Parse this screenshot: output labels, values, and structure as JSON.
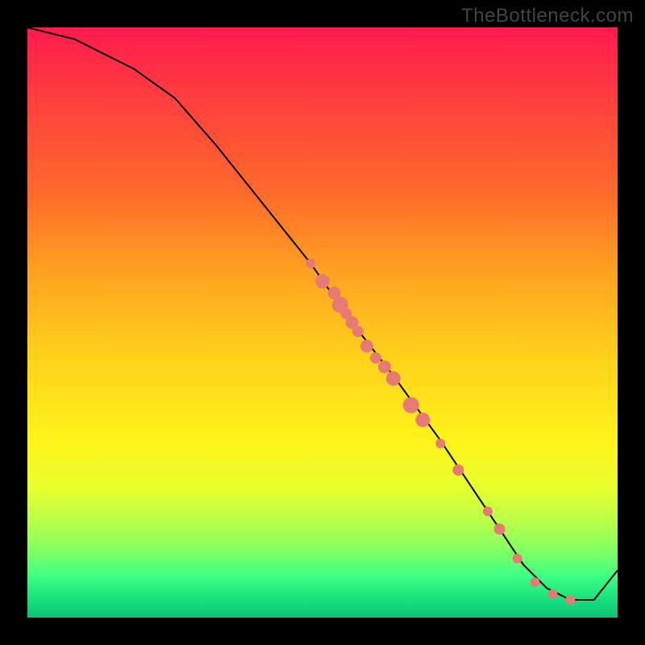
{
  "watermark": "TheBottleneck.com",
  "colors": {
    "page_bg": "#000000",
    "watermark": "#444444",
    "curve": "#000000",
    "dots": "#e87a74"
  },
  "chart_data": {
    "type": "line",
    "title": "",
    "xlabel": "",
    "ylabel": "",
    "xlim": [
      0,
      100
    ],
    "ylim": [
      0,
      100
    ],
    "grid": false,
    "legend": false,
    "curve": {
      "x": [
        0,
        4,
        8,
        12,
        18,
        25,
        32,
        40,
        48,
        55,
        62,
        70,
        78,
        84,
        88,
        92,
        96,
        100
      ],
      "y": [
        100,
        99,
        98,
        96,
        93,
        88,
        80,
        70,
        60,
        50,
        41,
        30,
        18,
        9,
        5,
        3,
        3,
        8
      ]
    },
    "scatter": [
      {
        "x": 48,
        "y": 60,
        "r": 6
      },
      {
        "x": 50,
        "y": 57,
        "r": 9
      },
      {
        "x": 52,
        "y": 55,
        "r": 8
      },
      {
        "x": 53,
        "y": 53,
        "r": 10
      },
      {
        "x": 54,
        "y": 51.5,
        "r": 7
      },
      {
        "x": 55,
        "y": 50,
        "r": 8
      },
      {
        "x": 56,
        "y": 48.5,
        "r": 7
      },
      {
        "x": 57.5,
        "y": 46,
        "r": 8
      },
      {
        "x": 59,
        "y": 44,
        "r": 7
      },
      {
        "x": 60.5,
        "y": 42.5,
        "r": 8
      },
      {
        "x": 62,
        "y": 40.5,
        "r": 9
      },
      {
        "x": 65,
        "y": 36,
        "r": 10
      },
      {
        "x": 67,
        "y": 33.5,
        "r": 9
      },
      {
        "x": 70,
        "y": 29.5,
        "r": 6
      },
      {
        "x": 73,
        "y": 25,
        "r": 7
      },
      {
        "x": 78,
        "y": 18,
        "r": 6
      },
      {
        "x": 80,
        "y": 15,
        "r": 7
      },
      {
        "x": 83,
        "y": 10,
        "r": 6
      },
      {
        "x": 86,
        "y": 6,
        "r": 6
      },
      {
        "x": 89,
        "y": 4,
        "r": 6
      },
      {
        "x": 92,
        "y": 3,
        "r": 6
      }
    ]
  }
}
